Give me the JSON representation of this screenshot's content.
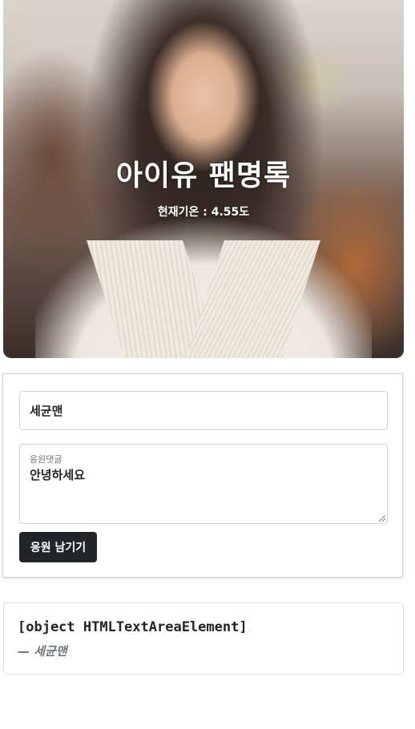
{
  "hero": {
    "title": "아이유 팬명록",
    "temperature_text": "현재기온 : 4.55도"
  },
  "form": {
    "name_value": "세균맨",
    "comment_label": "응원댓글",
    "comment_value": "안녕하세요",
    "submit_label": "응원 남기기"
  },
  "posts": [
    {
      "text": "[object HTMLTextAreaElement]",
      "author": "— 세균맨"
    }
  ],
  "colors": {
    "button_bg": "#212529",
    "muted_text": "#6c757d",
    "border": "#ced4da"
  }
}
